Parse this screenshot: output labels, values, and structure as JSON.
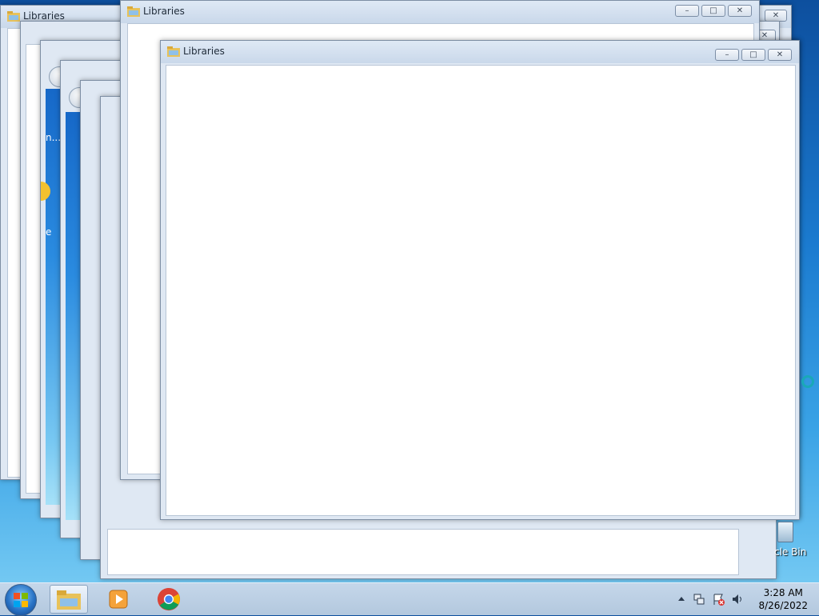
{
  "windows": {
    "back_title": "Libraries",
    "mid_title": "Libraries",
    "front_title": "Libraries"
  },
  "desktop": {
    "recycle_bin_label": "cle Bin",
    "fragment_text_1": "n...",
    "fragment_text_2": "e"
  },
  "taskbar": {
    "start_label": "Start",
    "pinned": [
      "windows-explorer",
      "windows-media-player",
      "google-chrome"
    ],
    "clock_time": "3:28 AM",
    "clock_date": "8/26/2022",
    "tray_icons": [
      "show-hidden-icons",
      "network-icon",
      "action-center-icon",
      "volume-icon"
    ]
  },
  "window_controls": {
    "minimize": "–",
    "maximize": "□",
    "close": "✕"
  },
  "colors": {
    "desktop_bg": "#1b7bd0",
    "window_frame": "#dfe8f3",
    "client_bg": "#ffffff"
  }
}
